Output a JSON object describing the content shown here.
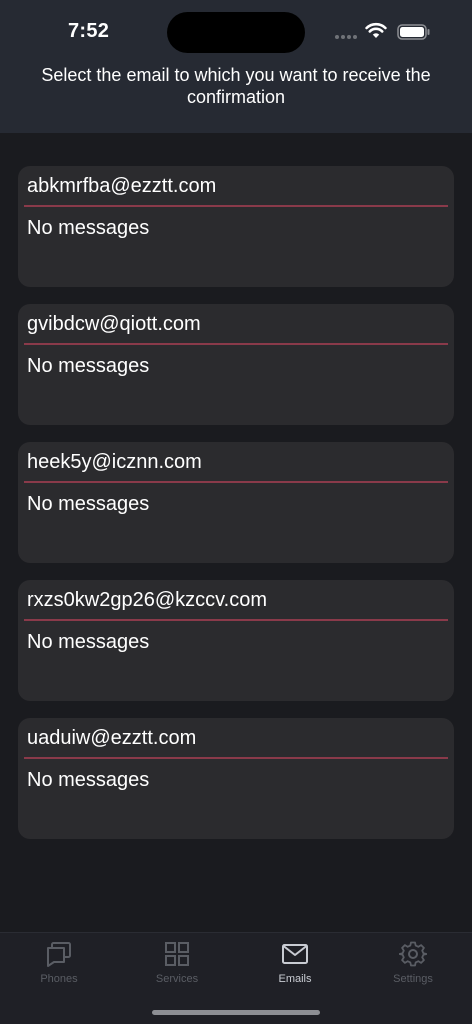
{
  "status_bar": {
    "time": "7:52"
  },
  "header": {
    "title": "Select the email to which you want to receive the confirmation"
  },
  "emails": [
    {
      "address": "abkmrfba@ezztt.com",
      "status": "No messages"
    },
    {
      "address": "gvibdcw@qiott.com",
      "status": "No messages"
    },
    {
      "address": "heek5y@icznn.com",
      "status": "No messages"
    },
    {
      "address": "rxzs0kw2gp26@kzccv.com",
      "status": "No messages"
    },
    {
      "address": "uaduiw@ezztt.com",
      "status": "No messages"
    }
  ],
  "tabs": [
    {
      "label": "Phones",
      "icon": "phones-icon",
      "active": false
    },
    {
      "label": "Services",
      "icon": "grid-icon",
      "active": false
    },
    {
      "label": "Emails",
      "icon": "envelope-icon",
      "active": true
    },
    {
      "label": "Settings",
      "icon": "gear-icon",
      "active": false
    }
  ],
  "colors": {
    "background": "#1a1b1f",
    "header": "#262a33",
    "card": "#2b2b2e",
    "divider_accent": "#8a3a4a",
    "tab_inactive": "#5a5d64",
    "tab_active": "#c9ccd3"
  }
}
